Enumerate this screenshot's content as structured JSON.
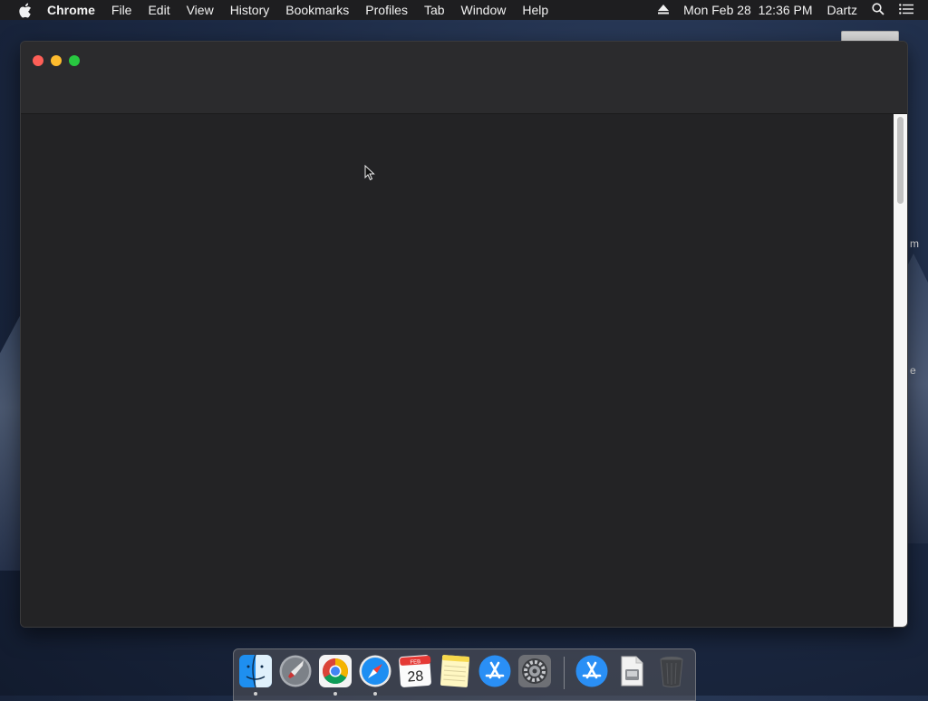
{
  "menubar": {
    "app_name": "Chrome",
    "items": [
      "File",
      "Edit",
      "View",
      "History",
      "Bookmarks",
      "Profiles",
      "Tab",
      "Window",
      "Help"
    ],
    "datetime": "Mon Feb 28  12:36 PM",
    "user": "Dartz"
  },
  "desktop": {
    "fragment_1": "m",
    "fragment_2": "e"
  },
  "dock": {
    "calendar_month": "FEB",
    "calendar_day": "28"
  },
  "colors": {
    "close": "#fe5f57",
    "minimize": "#febc2e",
    "zoom": "#28c840"
  }
}
